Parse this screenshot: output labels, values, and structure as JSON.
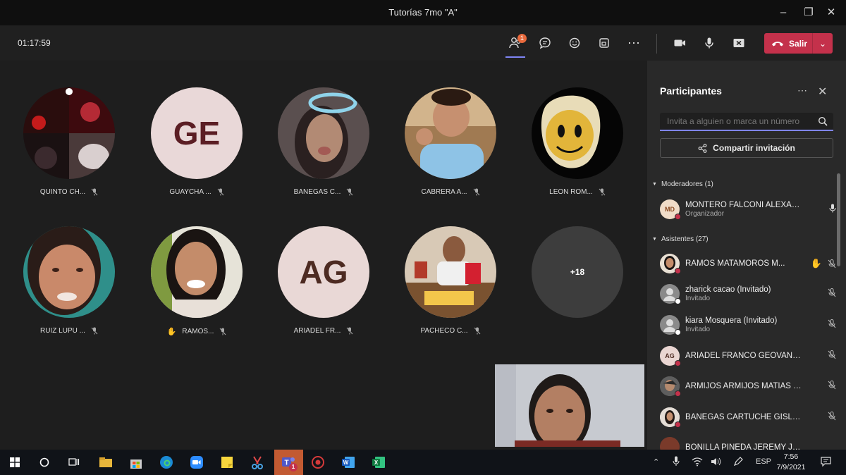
{
  "window": {
    "title": "Tutorías 7mo \"A\""
  },
  "toolbar": {
    "timer": "01:17:59",
    "participants_badge": "1",
    "leave_label": "Salir"
  },
  "tiles": [
    {
      "name": "QUINTO CH...",
      "avatar": "photo"
    },
    {
      "name": "GUAYCHA ...",
      "avatar": "initials",
      "initials": "GE"
    },
    {
      "name": "BANEGAS C...",
      "avatar": "photo"
    },
    {
      "name": "CABRERA A...",
      "avatar": "photo"
    },
    {
      "name": "LEON ROM...",
      "avatar": "photo"
    },
    {
      "name": "RUIZ LUPU ...",
      "avatar": "photo"
    },
    {
      "name": "RAMOS...",
      "avatar": "photo",
      "hand_raised": true
    },
    {
      "name": "ARIADEL FR...",
      "avatar": "initials",
      "initials": "AG"
    },
    {
      "name": "PACHECO C...",
      "avatar": "photo"
    },
    {
      "name": "+18",
      "avatar": "overflow"
    }
  ],
  "panel": {
    "title": "Participantes",
    "search_placeholder": "Invita a alguien o marca un número",
    "invite_label": "Compartir invitación",
    "moderators_header": "Moderadores (1)",
    "attendees_header": "Asistentes (27)",
    "moderators": [
      {
        "name": "MONTERO FALCONI ALEXAN...",
        "role": "Organizador",
        "initials": "MD"
      }
    ],
    "attendees": [
      {
        "name": "RAMOS MATAMOROS M...",
        "hand_raised": true
      },
      {
        "name": "zharick cacao (Invitado)",
        "role": "Invitado"
      },
      {
        "name": "kiara Mosquera (Invitado)",
        "role": "Invitado"
      },
      {
        "name": "ARIADEL FRANCO GEOVANN...",
        "initials": "AG"
      },
      {
        "name": "ARMIJOS ARMIJOS MATIAS E..."
      },
      {
        "name": "BANEGAS CARTUCHE GISLAY..."
      },
      {
        "name": "BONILLA PINEDA JEREMY JO..."
      }
    ]
  },
  "taskbar": {
    "language": "ESP",
    "time": "7:56",
    "date": "7/9/2021",
    "teams_badge": "1"
  },
  "colors": {
    "accent": "#7f85f5",
    "leave": "#c4314b",
    "busy_dot": "#c4314b",
    "offline_dot": "#ffffff"
  }
}
